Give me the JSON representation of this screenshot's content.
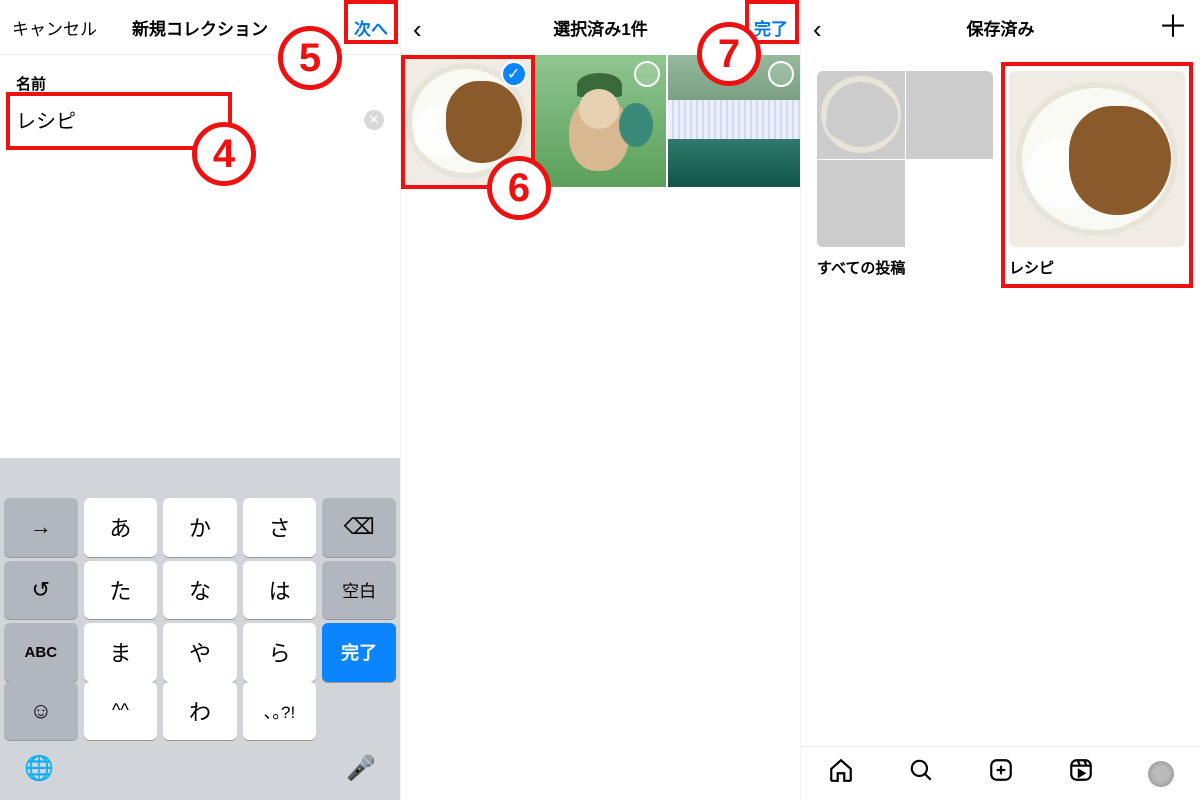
{
  "annotations": {
    "step4": "4",
    "step5": "5",
    "step6": "6",
    "step7": "7"
  },
  "pane1": {
    "header": {
      "cancel": "キャンセル",
      "title": "新規コレクション",
      "next": "次へ"
    },
    "field_label": "名前",
    "input_value": "レシピ",
    "clear_glyph": "✕",
    "keyboard": {
      "rows": [
        [
          "→",
          "あ",
          "か",
          "さ",
          "⌫"
        ],
        [
          "↺",
          "た",
          "な",
          "は",
          "空白"
        ],
        [
          "ABC",
          "ま",
          "や",
          "ら",
          ""
        ],
        [
          "☺",
          "^^",
          "わ",
          "､｡?!",
          "完了"
        ]
      ],
      "globe": "🌐",
      "mic": "🎤"
    }
  },
  "pane2": {
    "header": {
      "title": "選択済み1件",
      "done": "完了"
    },
    "thumbs": [
      {
        "kind": "curry",
        "selected": true
      },
      {
        "kind": "puppy",
        "selected": false
      },
      {
        "kind": "water",
        "selected": false
      }
    ]
  },
  "pane3": {
    "header": {
      "title": "保存済み"
    },
    "collections": [
      {
        "label": "すべての投稿",
        "kind": "grid"
      },
      {
        "label": "レシピ",
        "kind": "curry"
      }
    ]
  }
}
